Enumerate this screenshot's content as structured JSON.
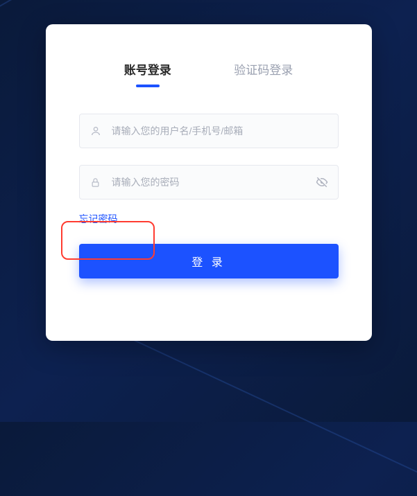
{
  "tabs": {
    "account": "账号登录",
    "sms": "验证码登录"
  },
  "fields": {
    "username_placeholder": "请输入您的用户名/手机号/邮箱",
    "password_placeholder": "请输入您的密码"
  },
  "links": {
    "forgot": "忘记密码"
  },
  "buttons": {
    "login": "登 录"
  },
  "colors": {
    "primary": "#1c52ff",
    "highlight": "#ff3b30"
  }
}
